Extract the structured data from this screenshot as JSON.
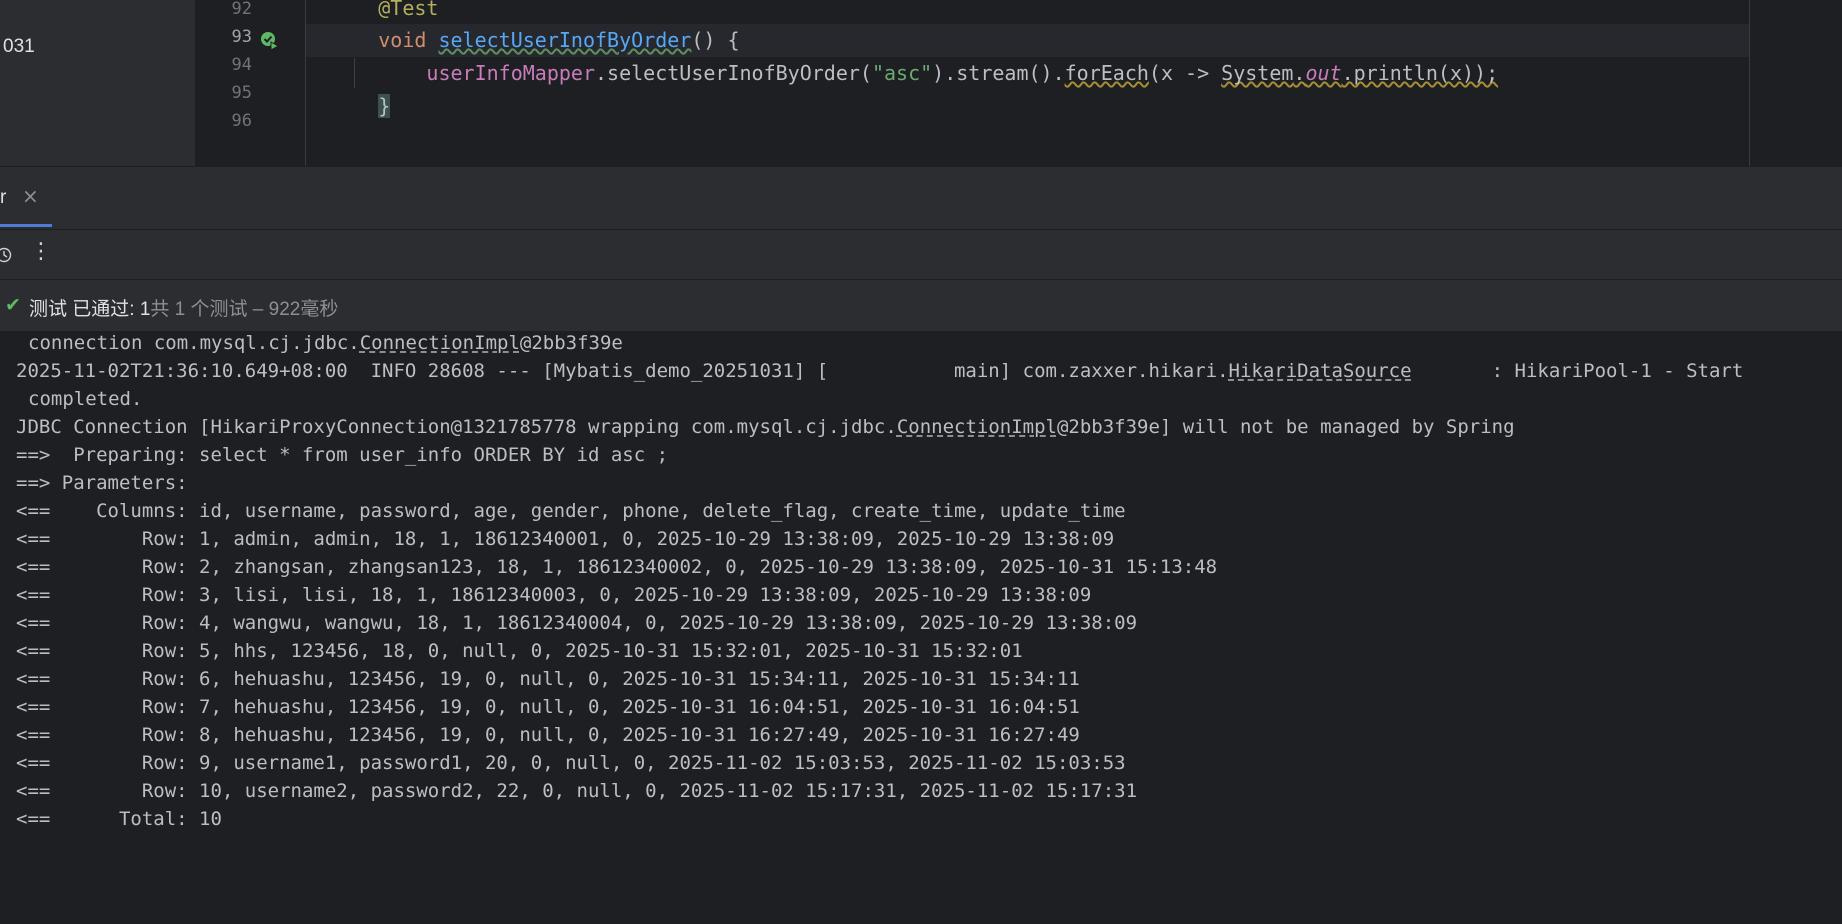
{
  "editor": {
    "left_label": "031",
    "gutter": {
      "line_numbers": [
        "92",
        "93",
        "94",
        "95",
        "96"
      ]
    },
    "code": {
      "line92": {
        "annotation": "@Test"
      },
      "line93": {
        "kw": "void",
        "method": "selectUserInofByOrder",
        "rest": "() {"
      },
      "line94": {
        "mapper": "userInfoMapper",
        "call": ".selectUserInofByOrder(",
        "arg": "\"asc\"",
        "stream": ").stream().",
        "foreach": "forEach",
        "lambda": "(x -> ",
        "system": "System",
        "dot": ".",
        "out": "out",
        "println": ".println(x));"
      },
      "line95": {
        "brace": "}"
      }
    }
  },
  "tool": {
    "tab": {
      "label": "r",
      "close": "×"
    },
    "toolbar": {
      "more": "⋮"
    },
    "status": {
      "check": "✔",
      "main": "测试 已通过: 1",
      "sub": "共 1 个测试 – 922毫秒"
    }
  },
  "console": {
    "lines": [
      {
        "a": "connection com.mysql.cj.jdbc.",
        "u": "ConnectionImpl",
        "b": "@2bb3f39e"
      },
      {
        "a": "2025-11-02T21:36:10.649+08:00  INFO 28608 --- [Mybatis_demo_20251031] [           main] com.zaxxer.hikari.",
        "u": "HikariDataSource",
        "b": "       : HikariPool-1 - Start"
      },
      {
        "a": "completed.",
        "u": "",
        "b": ""
      },
      {
        "a": "JDBC Connection [HikariProxyConnection@1321785778 wrapping com.mysql.cj.jdbc.",
        "u": "ConnectionImpl",
        "b": "@2bb3f39e] will not be managed by Spring"
      },
      {
        "a": "==>  Preparing: select * from user_info ORDER BY id asc ;",
        "u": "",
        "b": ""
      },
      {
        "a": "==> Parameters: ",
        "u": "",
        "b": ""
      },
      {
        "a": "<==    Columns: id, username, password, age, gender, phone, delete_flag, create_time, update_time",
        "u": "",
        "b": ""
      },
      {
        "a": "<==        Row: 1, admin, admin, 18, 1, 18612340001, 0, 2025-10-29 13:38:09, 2025-10-29 13:38:09",
        "u": "",
        "b": ""
      },
      {
        "a": "<==        Row: 2, zhangsan, zhangsan123, 18, 1, 18612340002, 0, 2025-10-29 13:38:09, 2025-10-31 15:13:48",
        "u": "",
        "b": ""
      },
      {
        "a": "<==        Row: 3, lisi, lisi, 18, 1, 18612340003, 0, 2025-10-29 13:38:09, 2025-10-29 13:38:09",
        "u": "",
        "b": ""
      },
      {
        "a": "<==        Row: 4, wangwu, wangwu, 18, 1, 18612340004, 0, 2025-10-29 13:38:09, 2025-10-29 13:38:09",
        "u": "",
        "b": ""
      },
      {
        "a": "<==        Row: 5, hhs, 123456, 18, 0, null, 0, 2025-10-31 15:32:01, 2025-10-31 15:32:01",
        "u": "",
        "b": ""
      },
      {
        "a": "<==        Row: 6, hehuashu, 123456, 19, 0, null, 0, 2025-10-31 15:34:11, 2025-10-31 15:34:11",
        "u": "",
        "b": ""
      },
      {
        "a": "<==        Row: 7, hehuashu, 123456, 19, 0, null, 0, 2025-10-31 16:04:51, 2025-10-31 16:04:51",
        "u": "",
        "b": ""
      },
      {
        "a": "<==        Row: 8, hehuashu, 123456, 19, 0, null, 0, 2025-10-31 16:27:49, 2025-10-31 16:27:49",
        "u": "",
        "b": ""
      },
      {
        "a": "<==        Row: 9, username1, password1, 20, 0, null, 0, 2025-11-02 15:03:53, 2025-11-02 15:03:53",
        "u": "",
        "b": ""
      },
      {
        "a": "<==        Row: 10, username2, password2, 22, 0, null, 0, 2025-11-02 15:17:31, 2025-11-02 15:17:31",
        "u": "",
        "b": ""
      },
      {
        "a": "<==      Total: 10",
        "u": "",
        "b": ""
      }
    ]
  },
  "colors": {
    "background": "#1e1f22",
    "panel": "#2b2d30",
    "keyword": "#cf8e6d",
    "method": "#56a8f5",
    "string": "#6aab73",
    "field": "#c77dbb",
    "success": "#5fb865",
    "accent": "#4e7bd6"
  }
}
